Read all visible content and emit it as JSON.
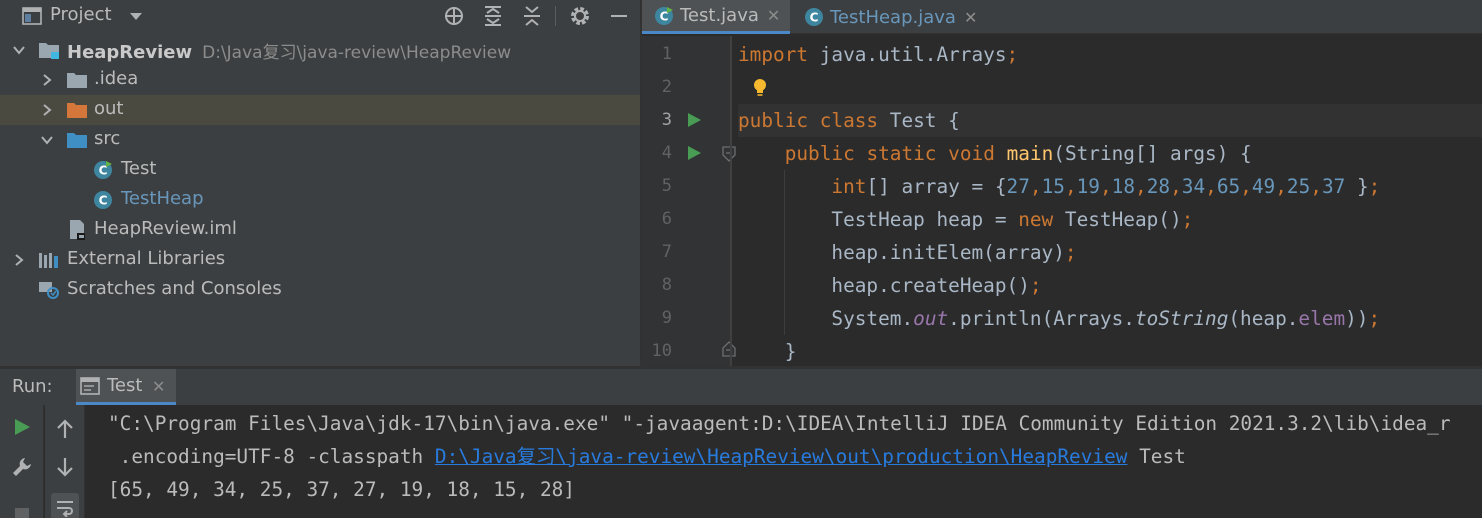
{
  "project_panel": {
    "title": "Project",
    "tree": [
      {
        "label": "HeapReview",
        "path": "D:\\Java复习\\java-review\\HeapReview",
        "icon": "module-folder-icon",
        "expanded": true
      },
      {
        "label": ".idea",
        "icon": "folder-icon",
        "expanded": false
      },
      {
        "label": "out",
        "icon": "excluded-folder-icon",
        "expanded": false
      },
      {
        "label": "src",
        "icon": "source-folder-icon",
        "expanded": true
      },
      {
        "label": "Test",
        "icon": "java-class-runnable-icon"
      },
      {
        "label": "TestHeap",
        "icon": "java-class-icon"
      },
      {
        "label": "HeapReview.iml",
        "icon": "module-file-icon"
      },
      {
        "label": "External Libraries",
        "icon": "libraries-icon",
        "expanded": false
      },
      {
        "label": "Scratches and Consoles",
        "icon": "scratches-icon"
      }
    ]
  },
  "editor": {
    "tabs": [
      {
        "label": "Test.java",
        "active": true
      },
      {
        "label": "TestHeap.java",
        "active": false
      }
    ],
    "line_numbers": [
      "1",
      "2",
      "3",
      "4",
      "5",
      "6",
      "7",
      "8",
      "9",
      "10"
    ],
    "code": {
      "l1_kw": "import",
      "l1_rest": " java.util.Arrays",
      "semi": ";",
      "l3_kw1": "public",
      "l3_kw2": "class",
      "l3_rest": " Test {",
      "l4_kw1": "public",
      "l4_kw2": "static",
      "l4_kw3": "void",
      "l4_fn": "main",
      "l4_rest": "(String[] args) {",
      "l5_kw": "int",
      "l5_mid": "[] array = {",
      "l5_nums": [
        "27",
        "15",
        "19",
        "18",
        "28",
        "34",
        "65",
        "49",
        "25",
        "37"
      ],
      "l5_end": " }",
      "l6_a": "TestHeap heap = ",
      "l6_kw": "new",
      "l6_b": " TestHeap()",
      "l7": "heap.initElem(array)",
      "l8": "heap.createHeap()",
      "l9_a": "System.",
      "l9_out": "out",
      "l9_b": ".println(Arrays.",
      "l9_tostr": "toString",
      "l9_c": "(heap.",
      "l9_elem": "elem",
      "l9_d": "))",
      "l10": "}"
    }
  },
  "run_panel": {
    "label": "Run:",
    "tab_label": "Test",
    "console": {
      "line1": "\"C:\\Program Files\\Java\\jdk-17\\bin\\java.exe\" \"-javaagent:D:\\IDEA\\IntelliJ IDEA Community Edition 2021.3.2\\lib\\idea_r",
      "line2_pre": " .encoding=UTF-8 -classpath ",
      "line2_link": "D:\\Java复习\\java-review\\HeapReview\\out\\production\\HeapReview",
      "line2_post": " Test",
      "line3": "[65, 49, 34, 25, 37, 27, 19, 18, 15, 28]"
    }
  },
  "colors": {
    "keyword": "#cc7832",
    "number": "#6897bb",
    "function": "#ffc66d",
    "field": "#9876aa",
    "link": "#287bde",
    "run_green": "#499c54"
  }
}
